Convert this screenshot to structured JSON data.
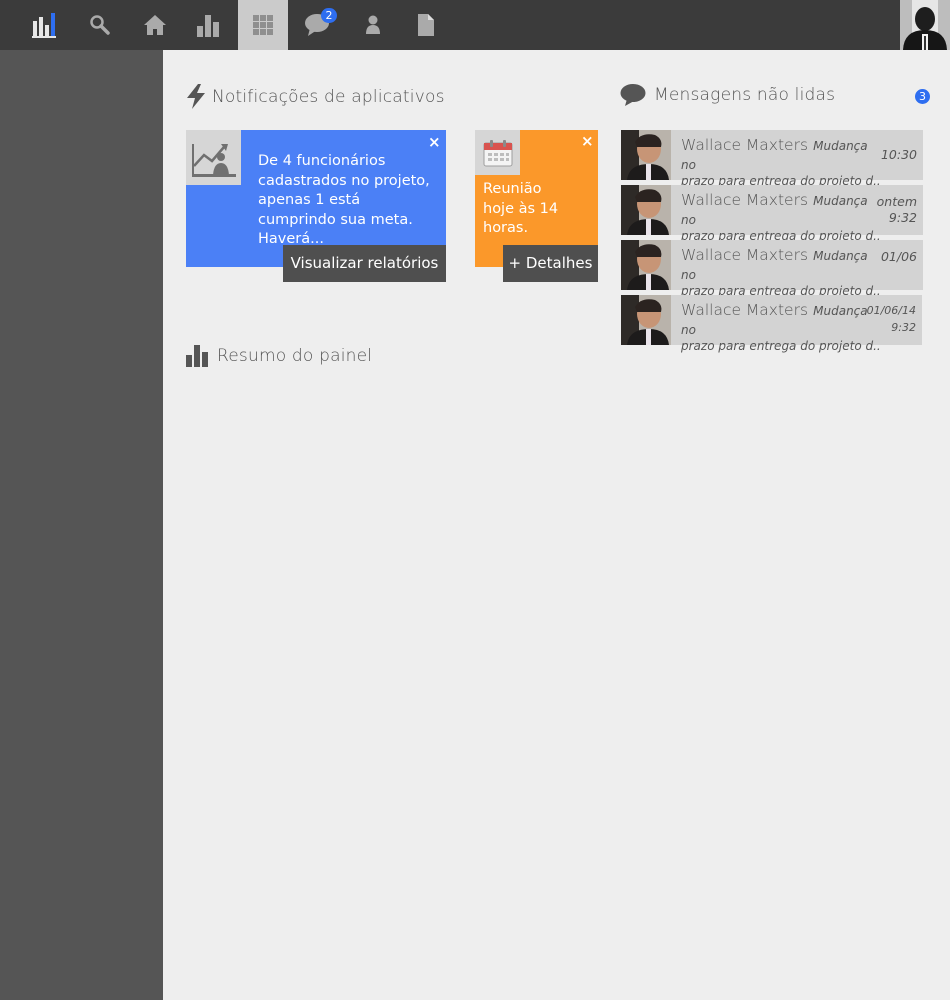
{
  "topbar": {
    "nav": [
      {
        "icon": "logo-bars-icon"
      },
      {
        "icon": "search-icon"
      },
      {
        "icon": "home-icon"
      },
      {
        "icon": "bar-chart-icon"
      },
      {
        "icon": "grid-icon",
        "active": true
      },
      {
        "icon": "chat-icon",
        "badge": "2"
      },
      {
        "icon": "user-icon"
      },
      {
        "icon": "document-icon"
      }
    ],
    "avatar_icon": "user-avatar"
  },
  "notifications": {
    "title": "Notificações de aplicativos",
    "title_icon": "lightning-icon",
    "cards": [
      {
        "icon": "chart-person-icon",
        "text": "De 4 funcionários cadastrados no projeto, apenas 1 está cumprindo sua meta. Haverá...",
        "action": "Visualizar relatórios",
        "close": "×",
        "color": "#4b80f6"
      },
      {
        "icon": "calendar-icon",
        "text": "Reunião hoje às 14 horas.",
        "action": "+ Detalhes",
        "close": "×",
        "color": "#fb982a"
      }
    ]
  },
  "messages": {
    "title": "Mensagens não lidas",
    "title_icon": "speech-bubble-icon",
    "count": "3",
    "items": [
      {
        "name": "Wallace Maxters",
        "subject": "Mudança no",
        "preview": "prazo para entrega do projeto d...",
        "time": "10:30"
      },
      {
        "name": "Wallace Maxters",
        "subject": "Mudança no",
        "preview": "prazo para entrega do projeto d...",
        "time": "ontem\n9:32"
      },
      {
        "name": "Wallace Maxters",
        "subject": "Mudança no",
        "preview": "prazo para entrega do projeto d...",
        "time": "01/06"
      },
      {
        "name": "Wallace Maxters",
        "subject": "Mudança no",
        "preview": "prazo para entrega do projeto d...",
        "time": "01/06/14\n9:32"
      }
    ]
  },
  "summary": {
    "title": "Resumo do painel",
    "title_icon": "bar-chart-icon"
  },
  "colors": {
    "topbar": "#3b3b3b",
    "sidebar": "#555555",
    "background": "#eeeeee",
    "accent_blue": "#2e6ef0"
  }
}
